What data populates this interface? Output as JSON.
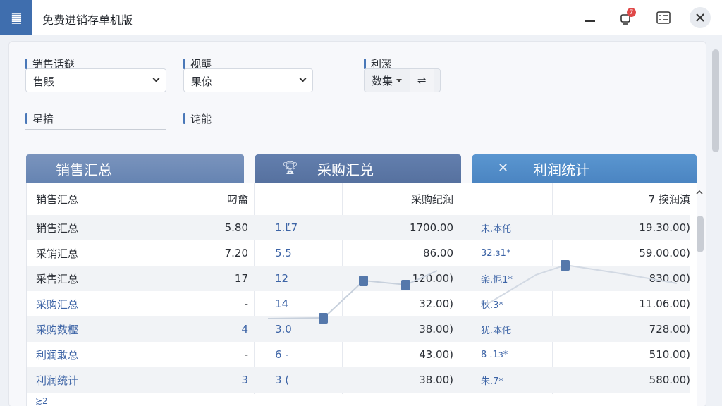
{
  "app": {
    "logo": "䷀",
    "title": "免费进销存单机版"
  },
  "titlebar": {
    "badge_count": "7"
  },
  "filters": {
    "channel": {
      "label": "销售话鎹",
      "value": "售賬"
    },
    "view": {
      "label": "视壟",
      "value": "果倞"
    },
    "profit": {
      "label": "利潔",
      "value": "数集",
      "extra": "⇌"
    },
    "stars": {
      "label": "星揞"
    },
    "func": {
      "label": "诧能"
    }
  },
  "sections": {
    "sales": "销售汇总",
    "purchase": "采购汇兑",
    "profit": "利润统计"
  },
  "table": {
    "header": {
      "name": "销售汇总",
      "v1": "叼龠",
      "v3": "采购纪润",
      "v5": "7 揬润滇"
    },
    "rows": [
      {
        "name": "销售汇总",
        "v1": "5.80",
        "v2": "1.Ľ7",
        "v3": "1700.00",
        "v4": "宋.本仛",
        "v5": "19.30.00)",
        "blue": false
      },
      {
        "name": "采销汇总",
        "v1": "7.20",
        "v2": "5.5",
        "v3": "86.00",
        "v4": "32.ɜ1*",
        "v5": "59.00.00)",
        "blue": false
      },
      {
        "name": "采售汇总",
        "v1": "17",
        "v2": "12",
        "v3": "120.00)",
        "v4": "楽.怩1*",
        "v5": "830.00)",
        "blue": false
      },
      {
        "name": "采购汇总",
        "v1": "-",
        "v2": "14",
        "v3": "32.00)",
        "v4": "秋.3*",
        "v5": "11.06.00)",
        "blue": true
      },
      {
        "name": "采购数樫",
        "v1": "4",
        "v2": "3.0",
        "v3": "38.00)",
        "v4": "犹.本仛",
        "v5": "728.00)",
        "blue": true
      },
      {
        "name": "利润敢总",
        "v1": "-",
        "v2": "6 -",
        "v3": "43.00)",
        "v4": "8 .1ɜ*",
        "v5": "510.00)",
        "blue": true
      },
      {
        "name": "利润统计",
        "v1": "3",
        "v2": "3 (",
        "v3": "38.00)",
        "v4": "朱.7*",
        "v5": "580.00)",
        "blue": true
      }
    ],
    "footer_mark": "≿2"
  },
  "colors": {
    "accent": "#4a78b8",
    "sales_header": "#6f8cb8",
    "purchase_header": "#5a76a4",
    "profit_header": "#5090cc"
  }
}
